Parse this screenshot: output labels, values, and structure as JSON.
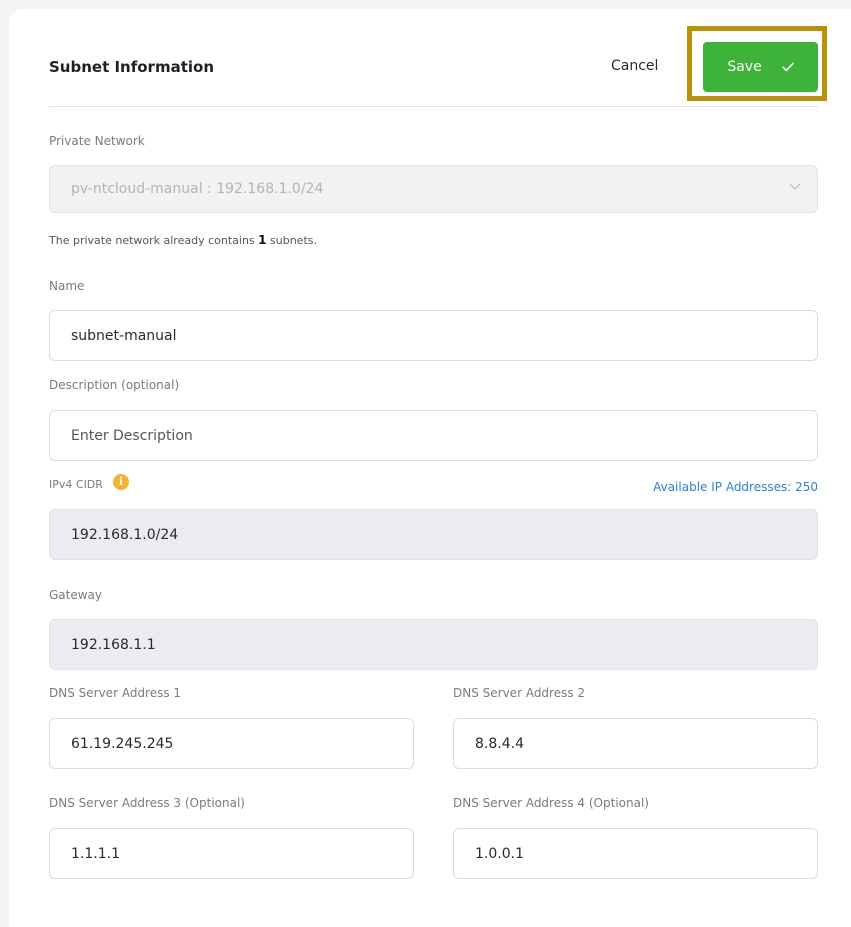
{
  "header": {
    "title": "Subnet Information",
    "cancel_label": "Cancel",
    "save_label": "Save"
  },
  "private_network": {
    "label": "Private Network",
    "selected": "pv-ntcloud-manual : 192.168.1.0/24",
    "hint_prefix": "The private network already contains",
    "hint_count": "1",
    "hint_suffix": "subnets."
  },
  "name": {
    "label": "Name",
    "value": "subnet-manual"
  },
  "description": {
    "label": "Description (optional)",
    "placeholder": "Enter Description"
  },
  "cidr": {
    "label": "IPv4 CIDR",
    "available": "Available IP Addresses: 250",
    "value": "192.168.1.0/24"
  },
  "gateway": {
    "label": "Gateway",
    "value": "192.168.1.1"
  },
  "dns": [
    {
      "label": "DNS Server Address 1",
      "value": "61.19.245.245"
    },
    {
      "label": "DNS Server Address 2",
      "value": "8.8.4.4"
    },
    {
      "label": "DNS Server Address 3 (Optional)",
      "value": "1.1.1.1"
    },
    {
      "label": "DNS Server Address 4 (Optional)",
      "value": "1.0.0.1"
    }
  ],
  "colors": {
    "save_button": "#3db33a",
    "highlight_border": "#b7920a",
    "link": "#2f7fd8",
    "info_icon": "#f2b233"
  },
  "icons": {
    "save": "checkmark-icon",
    "select": "chevron-down-icon",
    "cidr_info": "info-icon"
  }
}
